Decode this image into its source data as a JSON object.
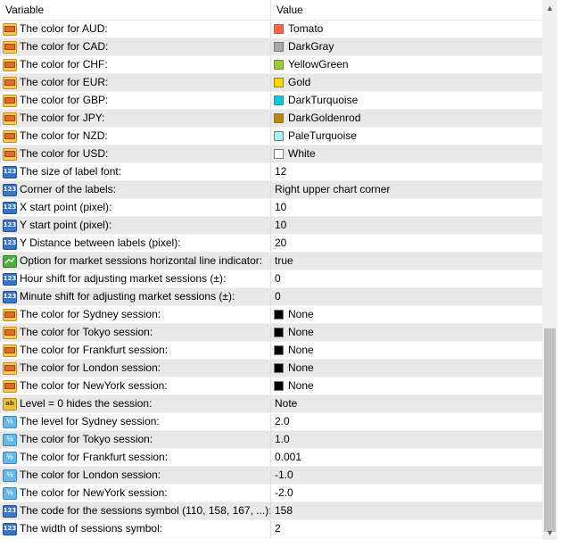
{
  "header": {
    "variable": "Variable",
    "value": "Value"
  },
  "rows": [
    {
      "name": "The color for AUD:",
      "value": "Tomato",
      "type": "color",
      "swatch": "#ff6347"
    },
    {
      "name": "The color for CAD:",
      "value": "DarkGray",
      "type": "color",
      "swatch": "#a9a9a9"
    },
    {
      "name": "The color for CHF:",
      "value": "YellowGreen",
      "type": "color",
      "swatch": "#9acd32"
    },
    {
      "name": "The color for EUR:",
      "value": "Gold",
      "type": "color",
      "swatch": "#ffd700"
    },
    {
      "name": "The color for GBP:",
      "value": "DarkTurquoise",
      "type": "color",
      "swatch": "#00ced1"
    },
    {
      "name": "The color for JPY:",
      "value": "DarkGoldenrod",
      "type": "color",
      "swatch": "#b8860b"
    },
    {
      "name": "The color for NZD:",
      "value": "PaleTurquoise",
      "type": "color",
      "swatch": "#afeeee"
    },
    {
      "name": "The color for USD:",
      "value": "White",
      "type": "color",
      "swatch": "#ffffff"
    },
    {
      "name": "The size of label font:",
      "value": "12",
      "type": "int"
    },
    {
      "name": "Corner of the labels:",
      "value": "Right upper chart corner",
      "type": "int"
    },
    {
      "name": "X start point (pixel):",
      "value": "10",
      "type": "int"
    },
    {
      "name": "Y start point (pixel):",
      "value": "10",
      "type": "int"
    },
    {
      "name": "Y Distance between labels (pixel):",
      "value": "20",
      "type": "int"
    },
    {
      "name": "Option for market sessions horizontal line indicator:",
      "value": "true",
      "type": "bool"
    },
    {
      "name": "Hour shift for adjusting market sessions (±):",
      "value": "0",
      "type": "int"
    },
    {
      "name": "Minute shift for adjusting market sessions (±):",
      "value": "0",
      "type": "int"
    },
    {
      "name": "The color for Sydney session:",
      "value": "None",
      "type": "color",
      "swatch": "#000000"
    },
    {
      "name": "The color for Tokyo session:",
      "value": "None",
      "type": "color",
      "swatch": "#000000"
    },
    {
      "name": "The color for Frankfurt session:",
      "value": "None",
      "type": "color",
      "swatch": "#000000"
    },
    {
      "name": "The color for London session:",
      "value": "None",
      "type": "color",
      "swatch": "#000000"
    },
    {
      "name": "The color for NewYork session:",
      "value": "None",
      "type": "color",
      "swatch": "#000000"
    },
    {
      "name": "Level = 0 hides the session:",
      "value": "Note",
      "type": "str"
    },
    {
      "name": "The level for Sydney session:",
      "value": "2.0",
      "type": "dbl"
    },
    {
      "name": "The color for Tokyo session:",
      "value": "1.0",
      "type": "dbl"
    },
    {
      "name": "The color for Frankfurt session:",
      "value": "0.001",
      "type": "dbl"
    },
    {
      "name": "The color for London session:",
      "value": "-1.0",
      "type": "dbl"
    },
    {
      "name": "The color for NewYork session:",
      "value": "-2.0",
      "type": "dbl"
    },
    {
      "name": "The code for the sessions symbol (110, 158, 167, ...):",
      "value": "158",
      "type": "int"
    },
    {
      "name": "The width of sessions symbol:",
      "value": "2",
      "type": "int"
    }
  ],
  "icons": {
    "color": "color-icon",
    "int": "integer-icon",
    "bool": "boolean-icon",
    "str": "string-icon",
    "dbl": "double-icon"
  },
  "icon_text": {
    "int": "123",
    "str": "ab",
    "dbl": "½"
  }
}
